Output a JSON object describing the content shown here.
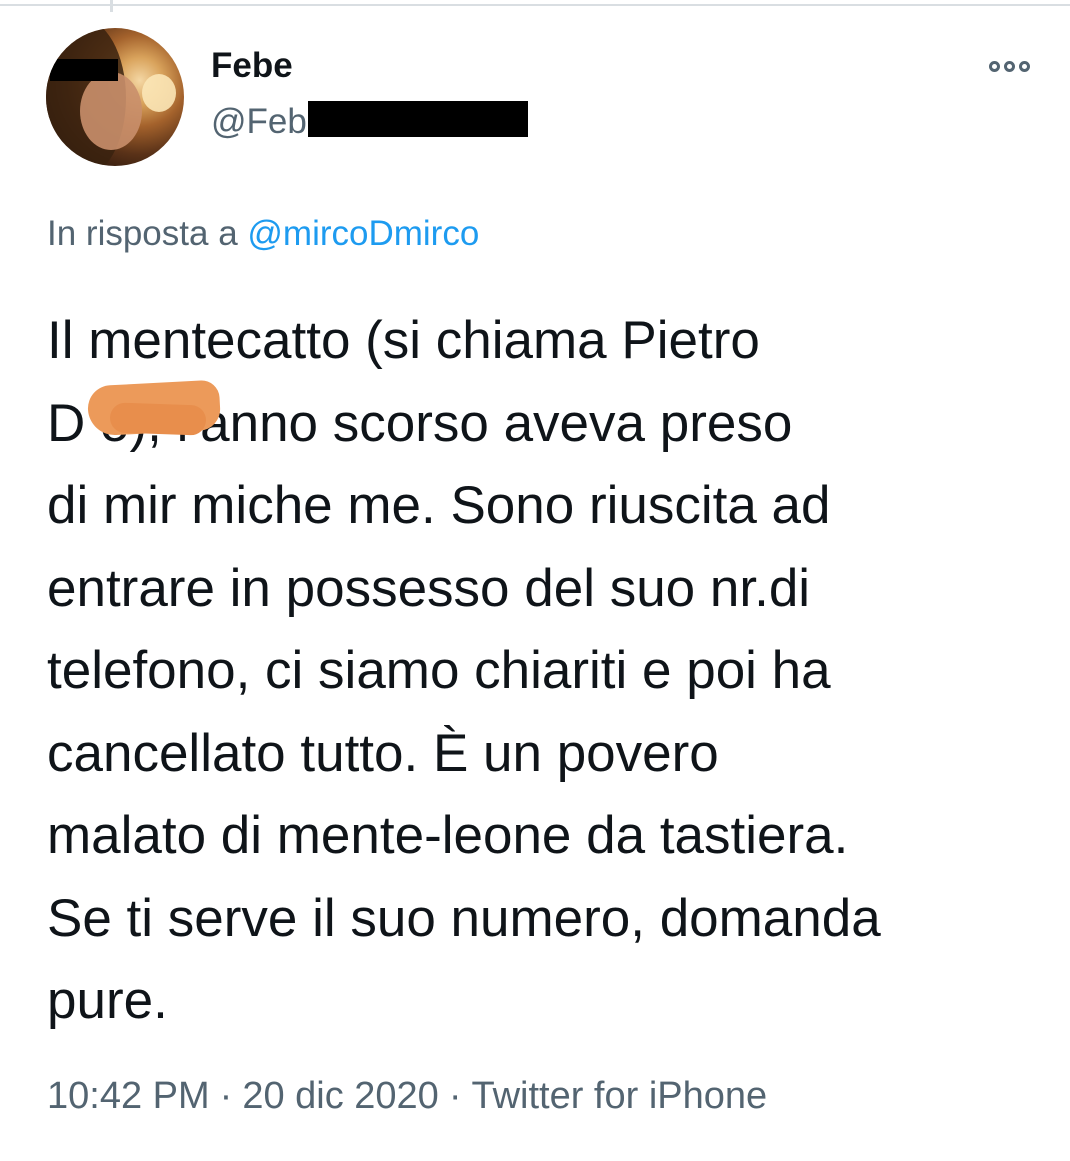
{
  "tweet": {
    "author": {
      "display_name": "Febe",
      "handle": "@Feb"
    },
    "reply_prefix": "In risposta a",
    "reply_to": "@mircoDmirco",
    "text_lines": [
      "Il mentecatto (si chiama Pietro",
      "D      o), l’anno scorso aveva preso",
      "di mir miche me. Sono riuscita ad",
      "entrare in possesso del suo nr.di",
      "telefono, ci siamo chiariti e poi ha",
      "cancellato tutto. È un povero",
      "malato di mente-leone da tastiera.",
      "Se ti serve il suo numero, domanda",
      "pure."
    ],
    "time": "10:42 PM",
    "separator": "·",
    "date": "20 dic 2020",
    "source": "Twitter for iPhone"
  },
  "icons": {
    "more": "more-options-icon"
  },
  "colors": {
    "text": "#0f1419",
    "secondary": "#536471",
    "link": "#1d9bf0",
    "redaction": "#000000",
    "scribble": "#ec9a5a"
  }
}
